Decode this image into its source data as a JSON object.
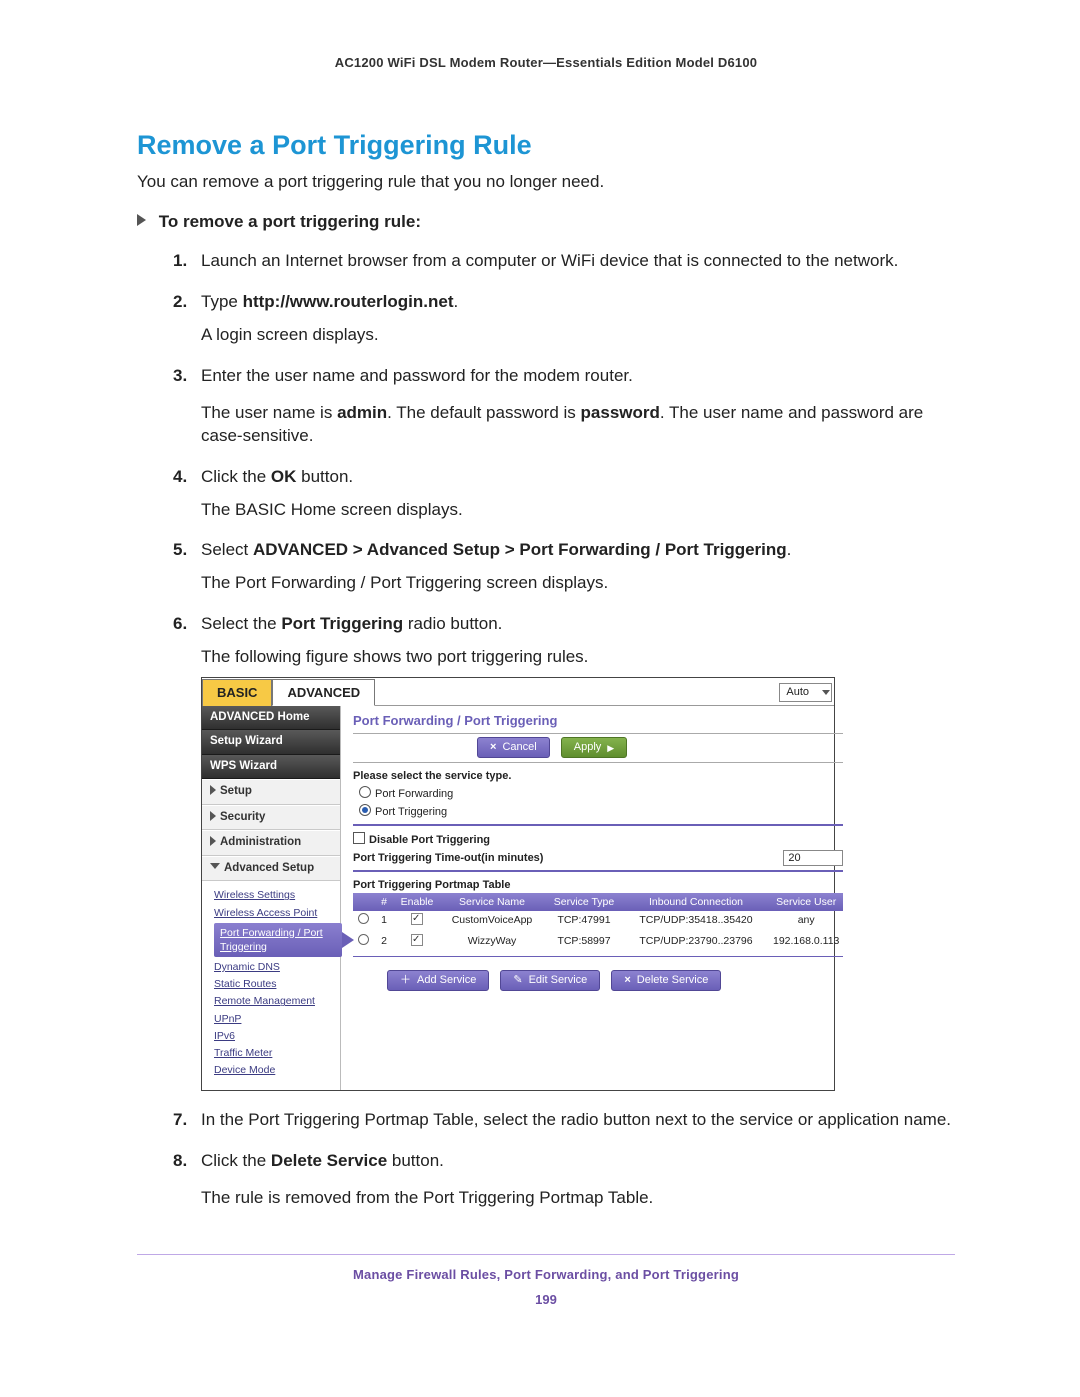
{
  "doc": {
    "header": "AC1200 WiFi DSL Modem Router—Essentials Edition Model D6100",
    "section_title": "Remove a Port Triggering Rule",
    "intro": "You can remove a port triggering rule that you no longer need.",
    "proc_title": "To remove a port triggering rule:",
    "footer": "Manage Firewall Rules, Port Forwarding, and Port Triggering",
    "page_number": "199"
  },
  "steps": {
    "s1": "Launch an Internet browser from a computer or WiFi device that is connected to the network.",
    "s2_pre": "Type ",
    "s2_bold": "http://www.routerlogin.net",
    "s2_post": ".",
    "s2_line2": "A login screen displays.",
    "s3_a": "Enter the user name and password for the modem router.",
    "s3_b_pre1": "The user name is ",
    "s3_b_b1": "admin",
    "s3_b_mid": ". The default password is ",
    "s3_b_b2": "password",
    "s3_b_post": ". The user name and password are case-sensitive.",
    "s4_pre": "Click the ",
    "s4_bold": "OK",
    "s4_post": " button.",
    "s4_line2": "The BASIC Home screen displays.",
    "s5_pre": "Select ",
    "s5_bold": "ADVANCED > Advanced Setup > Port Forwarding / Port Triggering",
    "s5_post": ".",
    "s5_line2": "The Port Forwarding / Port Triggering screen displays.",
    "s6_pre": "Select the ",
    "s6_bold": "Port Triggering",
    "s6_post": " radio button.",
    "s6_line2": "The following figure shows two port triggering rules.",
    "s7": "In the Port Triggering Portmap Table, select the radio button next to the service or application name.",
    "s8_pre": "Click the ",
    "s8_bold": "Delete Service",
    "s8_post": " button.",
    "s8_line2": "The rule is removed from the Port Triggering Portmap Table."
  },
  "ui": {
    "tabs": {
      "basic": "BASIC",
      "advanced": "ADVANCED"
    },
    "lang": "Auto",
    "sidebar": {
      "home": "ADVANCED Home",
      "wizard": "Setup Wizard",
      "wps": "WPS Wizard",
      "setup": "Setup",
      "security": "Security",
      "admin": "Administration",
      "advsetup": "Advanced Setup",
      "sub": {
        "wireless": "Wireless Settings",
        "wap": "Wireless Access Point",
        "pfpt": "Port Forwarding / Port Triggering",
        "ddns": "Dynamic DNS",
        "static": "Static Routes",
        "remote": "Remote Management",
        "upnp": "UPnP",
        "ipv6": "IPv6",
        "traffic": "Traffic Meter",
        "devmode": "Device Mode"
      }
    },
    "main": {
      "title": "Port Forwarding / Port Triggering",
      "cancel": "Cancel",
      "apply": "Apply",
      "select_label": "Please select the service type.",
      "radio_pf": "Port Forwarding",
      "radio_pt": "Port Triggering",
      "disable": "Disable Port Triggering",
      "timeout_label": "Port Triggering Time-out(in minutes)",
      "timeout_value": "20",
      "table_title": "Port Triggering Portmap Table",
      "cols": {
        "num": "#",
        "enable": "Enable",
        "name": "Service Name",
        "type": "Service Type",
        "inbound": "Inbound Connection",
        "user": "Service User"
      },
      "rows": [
        {
          "n": "1",
          "name": "CustomVoiceApp",
          "type": "TCP:47991",
          "in": "TCP/UDP:35418..35420",
          "user": "any"
        },
        {
          "n": "2",
          "name": "WizzyWay",
          "type": "TCP:58997",
          "in": "TCP/UDP:23790..23796",
          "user": "192.168.0.113"
        }
      ],
      "add": "Add Service",
      "edit": "Edit Service",
      "delete": "Delete Service"
    }
  }
}
